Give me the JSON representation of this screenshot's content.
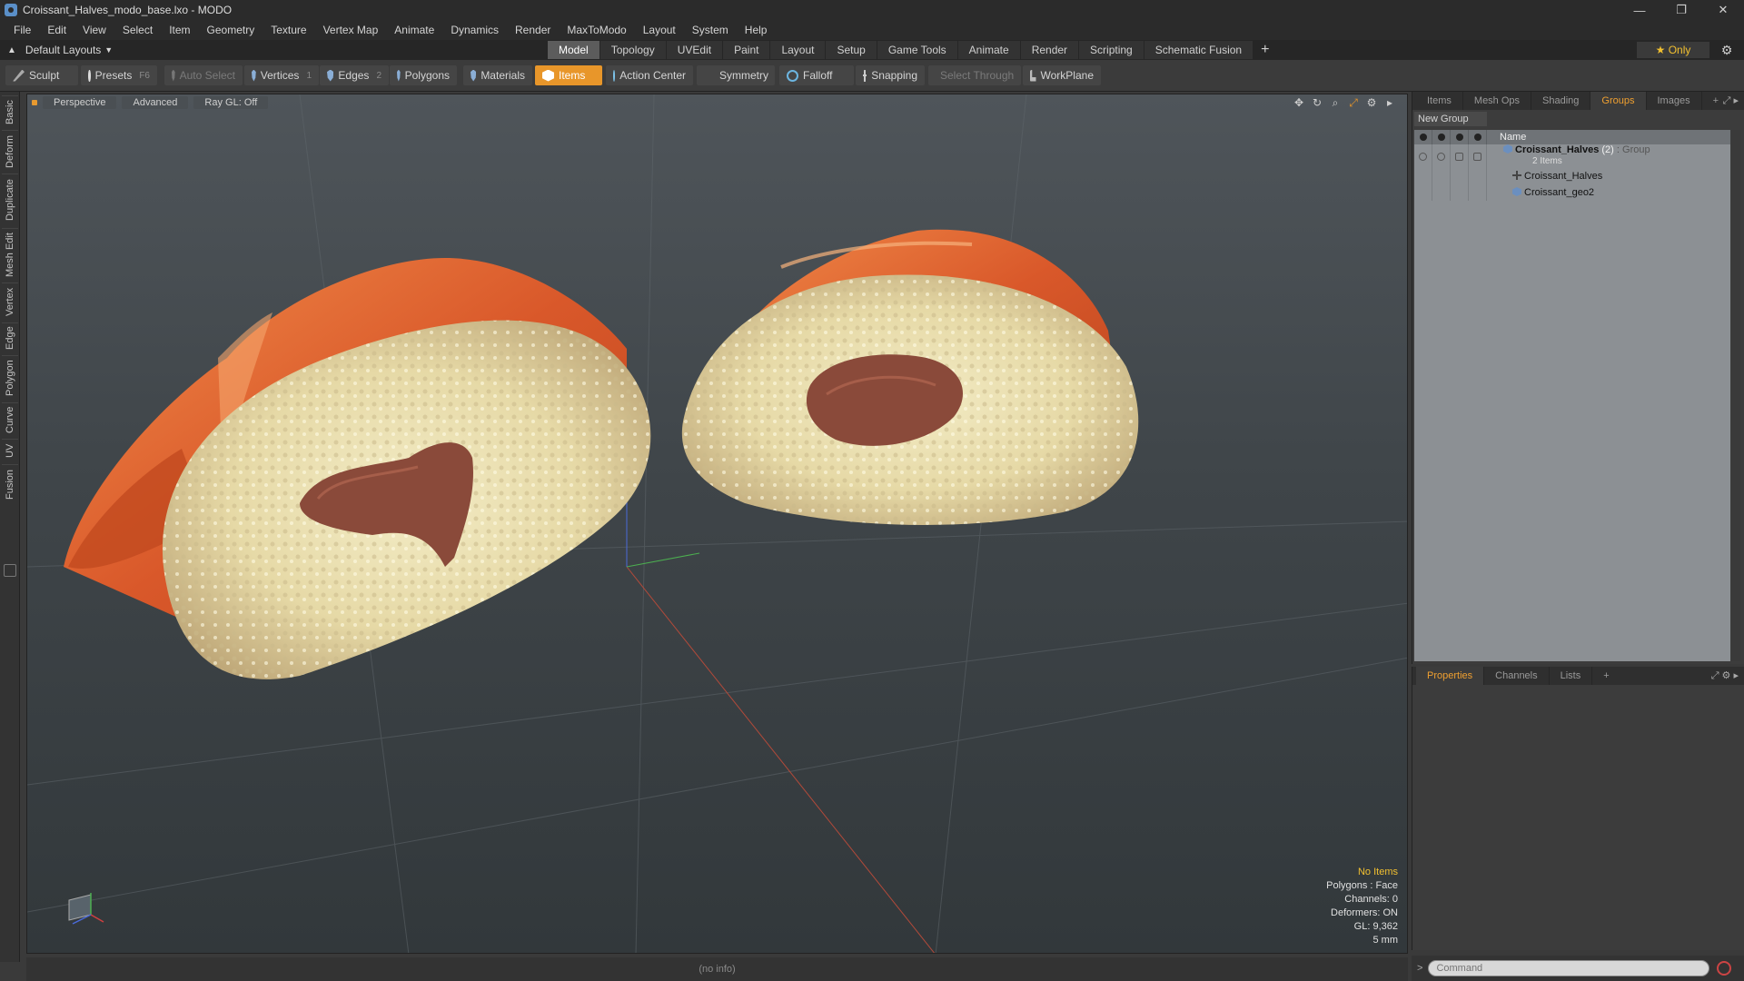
{
  "window": {
    "title": "Croissant_Halves_modo_base.lxo - MODO",
    "minimize": "—",
    "maximize": "❐",
    "close": "✕"
  },
  "menu": [
    "File",
    "Edit",
    "View",
    "Select",
    "Item",
    "Geometry",
    "Texture",
    "Vertex Map",
    "Animate",
    "Dynamics",
    "Render",
    "MaxToModo",
    "Layout",
    "System",
    "Help"
  ],
  "layout": {
    "default_layouts": "Default Layouts",
    "tabs": [
      "Model",
      "Topology",
      "UVEdit",
      "Paint",
      "Layout",
      "Setup",
      "Game Tools",
      "Animate",
      "Render",
      "Scripting",
      "Schematic Fusion"
    ],
    "active_tab": "Model",
    "plus": "+",
    "only": "★  Only",
    "gear": "⚙"
  },
  "toolbar": {
    "sculpt": "Sculpt",
    "presets": "Presets",
    "presets_key": "F6",
    "auto_select": "Auto Select",
    "vertices": "Vertices",
    "vertices_key": "1",
    "edges": "Edges",
    "edges_key": "2",
    "polygons": "Polygons",
    "materials": "Materials",
    "items": "Items",
    "action_center": "Action Center",
    "symmetry": "Symmetry",
    "falloff": "Falloff",
    "snapping": "Snapping",
    "select_through": "Select Through",
    "workplane": "WorkPlane"
  },
  "left_tabs": [
    "Basic",
    "Deform",
    "Duplicate",
    "Mesh Edit",
    "Vertex",
    "Edge",
    "Polygon",
    "Curve",
    "UV",
    "Fusion"
  ],
  "viewport": {
    "perspective": "Perspective",
    "advanced": "Advanced",
    "raygl": "Ray GL: Off",
    "hud": {
      "no_items": "No Items",
      "polygons": "Polygons : Face",
      "channels": "Channels: 0",
      "deformers": "Deformers: ON",
      "gl": "GL: 9,362",
      "units": "5 mm"
    }
  },
  "groups_panel": {
    "tabs": [
      "Items",
      "Mesh Ops",
      "Shading",
      "Groups",
      "Images"
    ],
    "active_tab": "Groups",
    "plus": "+",
    "new_group": "New Group",
    "col_name": "Name",
    "group": {
      "name": "Croissant_Halves",
      "count": "(2)",
      "type": ": Group",
      "sub": "2 Items"
    },
    "children": [
      "Croissant_Halves",
      "Croissant_geo2"
    ]
  },
  "props_panel": {
    "tabs": [
      "Properties",
      "Channels",
      "Lists"
    ],
    "active_tab": "Properties",
    "plus": "+"
  },
  "status": {
    "info": "(no info)"
  },
  "command": {
    "placeholder": "Command",
    "chevron": ">"
  },
  "colors": {
    "accent": "#e8962a",
    "viewport_top": "#4f555a",
    "viewport_bottom": "#32383b"
  }
}
